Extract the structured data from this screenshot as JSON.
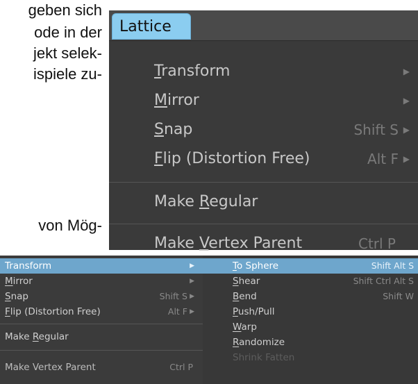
{
  "document": {
    "lines": [
      "geben sich",
      "ode in der",
      "jekt selek-",
      "ispiele zu-",
      "von Mög-"
    ]
  },
  "big_menu": {
    "header_title": "Lattice",
    "items": [
      {
        "pre": "",
        "u": "T",
        "post": "ransform",
        "shortcut": "",
        "submenu": true
      },
      {
        "pre": "",
        "u": "M",
        "post": "irror",
        "shortcut": "",
        "submenu": true
      },
      {
        "pre": "",
        "u": "S",
        "post": "nap",
        "shortcut": "Shift S",
        "submenu": true
      },
      {
        "pre": "",
        "u": "F",
        "post": "lip (Distortion Free)",
        "shortcut": "Alt F",
        "submenu": true
      },
      {
        "pre": "Make ",
        "u": "R",
        "post": "egular",
        "shortcut": "",
        "submenu": false
      },
      {
        "pre": "Make ",
        "u": "V",
        "post": "ertex Parent",
        "shortcut": "Ctrl P",
        "submenu": false
      }
    ]
  },
  "small_menu": {
    "items": [
      {
        "pre": "",
        "u": "",
        "post": "Transform",
        "shortcut": "",
        "submenu": true,
        "highlighted": true
      },
      {
        "pre": "",
        "u": "M",
        "post": "irror",
        "shortcut": "",
        "submenu": true,
        "highlighted": false
      },
      {
        "pre": "",
        "u": "S",
        "post": "nap",
        "shortcut": "Shift S",
        "submenu": true,
        "highlighted": false
      },
      {
        "pre": "",
        "u": "F",
        "post": "lip (Distortion Free)",
        "shortcut": "Alt F",
        "submenu": true,
        "highlighted": false
      },
      {
        "pre": "Make ",
        "u": "R",
        "post": "egular",
        "shortcut": "",
        "submenu": false,
        "highlighted": false
      },
      {
        "pre": "Make Vertex Parent",
        "u": "",
        "post": "",
        "shortcut": "Ctrl P",
        "submenu": false,
        "highlighted": false
      }
    ]
  },
  "submenu": {
    "items": [
      {
        "pre": "",
        "u": "T",
        "post": "o Sphere",
        "shortcut": "Shift Alt S",
        "highlighted": true,
        "disabled": false
      },
      {
        "pre": "",
        "u": "S",
        "post": "hear",
        "shortcut": "Shift Ctrl Alt S",
        "highlighted": false,
        "disabled": false
      },
      {
        "pre": "",
        "u": "B",
        "post": "end",
        "shortcut": "Shift W",
        "highlighted": false,
        "disabled": false
      },
      {
        "pre": "",
        "u": "P",
        "post": "ush/Pull",
        "shortcut": "",
        "highlighted": false,
        "disabled": false
      },
      {
        "pre": "",
        "u": "W",
        "post": "arp",
        "shortcut": "",
        "highlighted": false,
        "disabled": false
      },
      {
        "pre": "",
        "u": "R",
        "post": "andomize",
        "shortcut": "",
        "highlighted": false,
        "disabled": false
      },
      {
        "pre": "Shrink Fatten",
        "u": "",
        "post": "",
        "shortcut": "",
        "highlighted": false,
        "disabled": true
      }
    ]
  },
  "colors": {
    "highlight": "#6ea6cc",
    "tab": "#8bcdf0",
    "menu_bg": "#3a3a3a"
  }
}
